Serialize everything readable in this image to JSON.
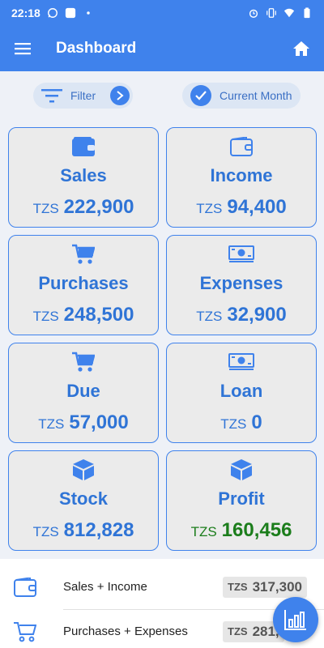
{
  "status_bar": {
    "time": "22:18",
    "icons_left": [
      "whatsapp-icon",
      "app-square-icon",
      "dot-icon"
    ],
    "icons_right": [
      "alarm-icon",
      "vibrate-icon",
      "wifi-icon",
      "battery-icon"
    ]
  },
  "app_bar": {
    "title": "Dashboard"
  },
  "filters": {
    "filter_label": "Filter",
    "period_label": "Current Month"
  },
  "cards": [
    {
      "label": "Sales",
      "currency": "TZS",
      "value": "222,900",
      "icon": "wallet-icon"
    },
    {
      "label": "Income",
      "currency": "TZS",
      "value": "94,400",
      "icon": "wallet-icon"
    },
    {
      "label": "Purchases",
      "currency": "TZS",
      "value": "248,500",
      "icon": "cart-icon"
    },
    {
      "label": "Expenses",
      "currency": "TZS",
      "value": "32,900",
      "icon": "money-icon"
    },
    {
      "label": "Due",
      "currency": "TZS",
      "value": "57,000",
      "icon": "cart-icon"
    },
    {
      "label": "Loan",
      "currency": "TZS",
      "value": "0",
      "icon": "money-icon"
    },
    {
      "label": "Stock",
      "currency": "TZS",
      "value": "812,828",
      "icon": "box-icon"
    },
    {
      "label": "Profit",
      "currency": "TZS",
      "value": "160,456",
      "icon": "box-icon"
    }
  ],
  "summary": [
    {
      "label": "Sales + Income",
      "currency": "TZS",
      "value": "317,300",
      "icon": "wallet-icon"
    },
    {
      "label": "Purchases + Expenses",
      "currency": "TZS",
      "value": "281,",
      "icon": "cart-icon"
    }
  ],
  "colors": {
    "primary": "#3f82ec",
    "positive": "#1b7d1b",
    "card_bg": "#ebebeb"
  }
}
